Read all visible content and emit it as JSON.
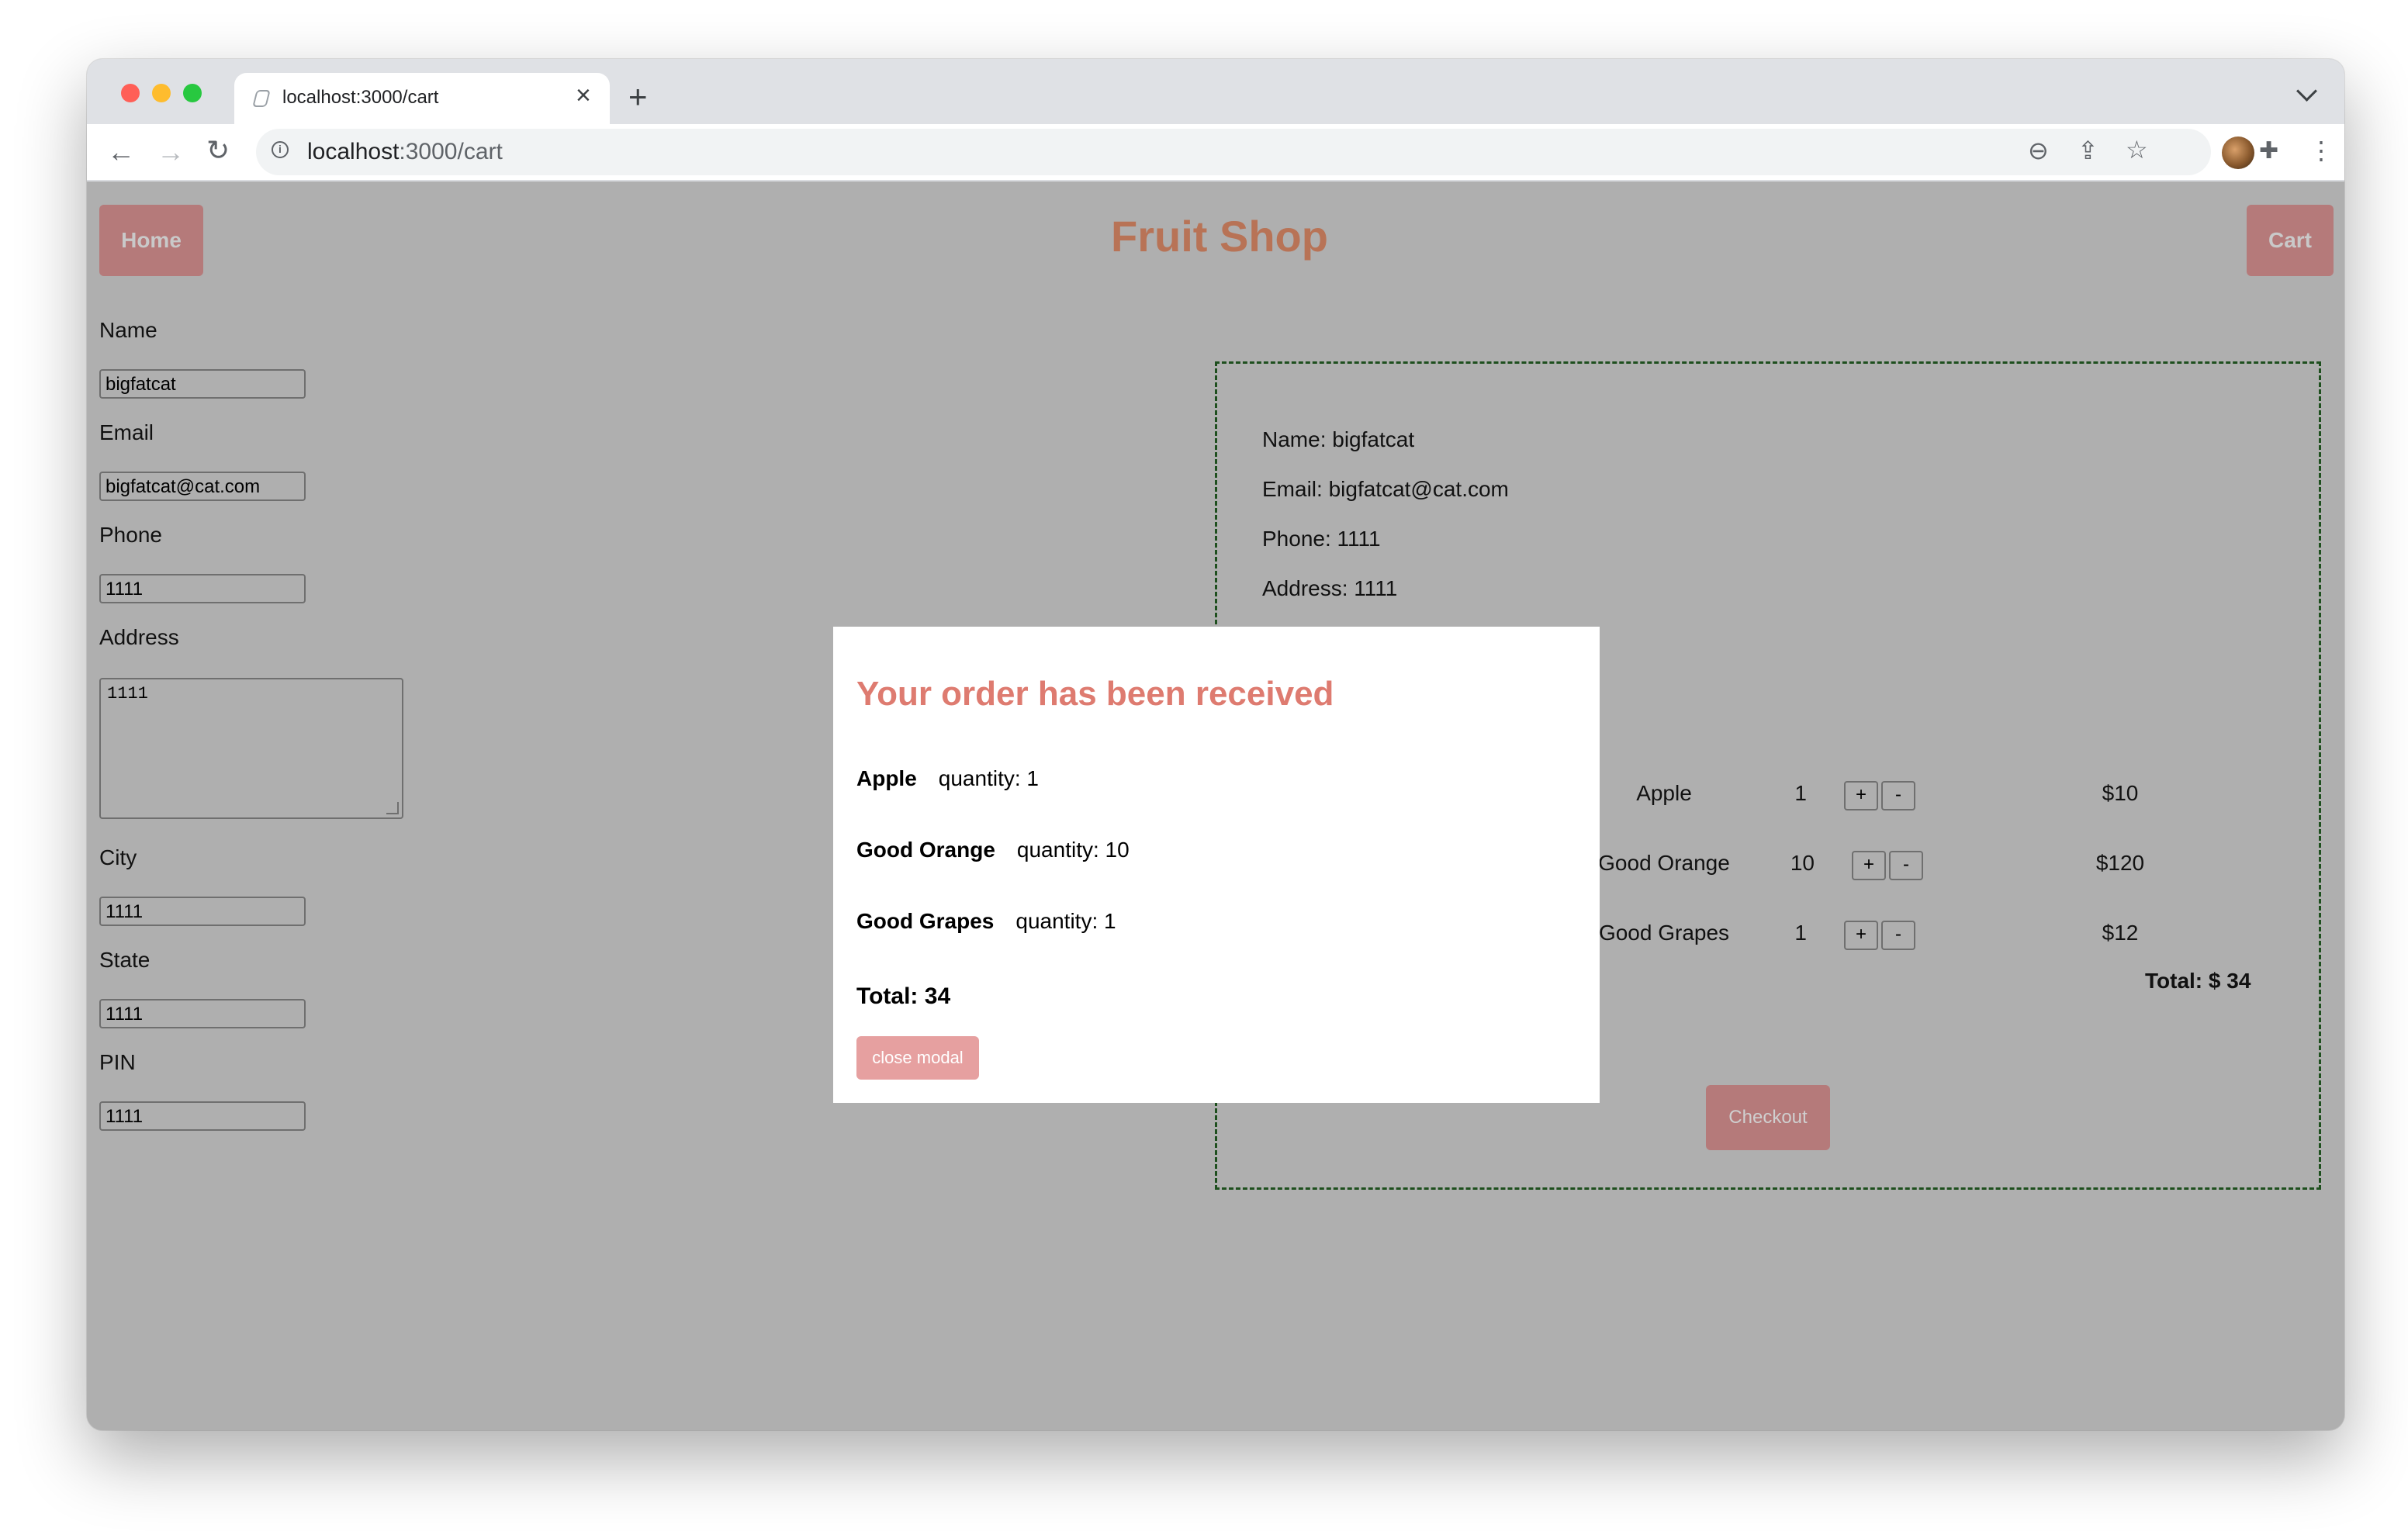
{
  "browser": {
    "tab_title": "localhost:3000/cart",
    "url_host": "localhost",
    "url_path": ":3000/cart"
  },
  "header": {
    "home_label": "Home",
    "title": "Fruit Shop",
    "cart_label": "Cart"
  },
  "form": {
    "name_label": "Name",
    "name_value": "bigfatcat",
    "email_label": "Email",
    "email_value": "bigfatcat@cat.com",
    "phone_label": "Phone",
    "phone_value": "1111",
    "address_label": "Address",
    "address_value": "1111",
    "city_label": "City",
    "city_value": "1111",
    "state_label": "State",
    "state_value": "1111",
    "pin_label": "PIN",
    "pin_value": "1111"
  },
  "summary": {
    "name_line": "Name: bigfatcat",
    "email_line": "Email: bigfatcat@cat.com",
    "phone_line": "Phone: 1111",
    "address_line": "Address: 1111",
    "items": [
      {
        "name": "Apple",
        "qty": "1",
        "price": "$10"
      },
      {
        "name": "Good Orange",
        "qty": "10",
        "price": "$120"
      },
      {
        "name": "Good Grapes",
        "qty": "1",
        "price": "$12"
      }
    ],
    "plus_label": "+",
    "minus_label": "-",
    "total": "Total: $ 34",
    "checkout_label": "Checkout"
  },
  "modal": {
    "title": "Your order has been received",
    "items": [
      {
        "name": "Apple",
        "qty_text": "quantity: 1"
      },
      {
        "name": "Good Orange",
        "qty_text": "quantity: 10"
      },
      {
        "name": "Good Grapes",
        "qty_text": "quantity: 1"
      }
    ],
    "total": "Total: 34",
    "close_label": "close modal"
  }
}
